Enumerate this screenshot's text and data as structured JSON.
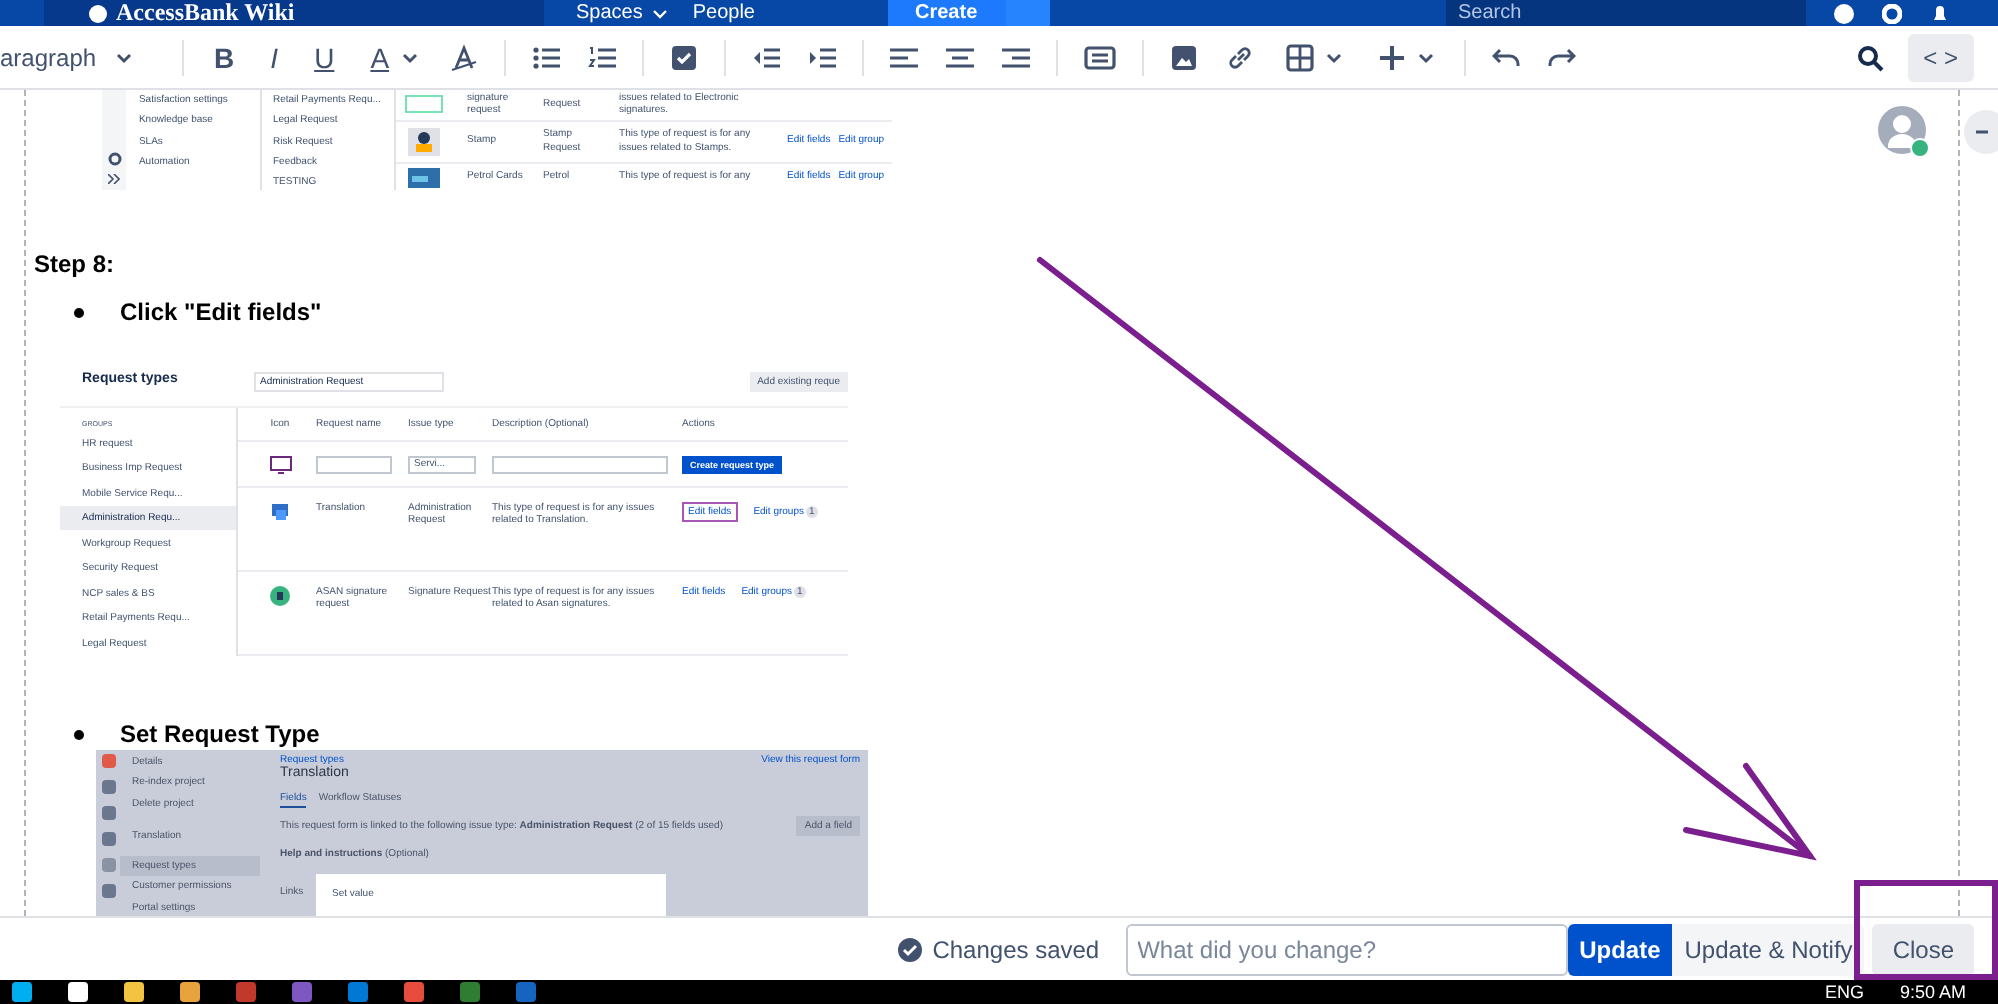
{
  "top_nav": {
    "logo": "AccessBank Wiki",
    "links": [
      "Spaces",
      "People"
    ],
    "create": "Create",
    "search_placeholder": "Search"
  },
  "toolbar": {
    "style_dropdown": "aragraph",
    "format_buttons": [
      {
        "label": "B",
        "kind": "bold"
      },
      {
        "label": "I",
        "kind": "italic"
      },
      {
        "label": "U",
        "kind": "underline"
      }
    ],
    "text_color": "A",
    "code_button": "< >"
  },
  "document": {
    "screenshot_top": {
      "sidebar": [
        "Satisfaction settings",
        "Knowledge base",
        "SLAs",
        "Automation"
      ],
      "groups": [
        "Retail Payments Requ...",
        "Legal Request",
        "Risk Request",
        "Feedback",
        "TESTING"
      ],
      "rows": [
        {
          "name": "signature request",
          "type": "Request",
          "description": "issues related to Electronic signatures.",
          "actions": []
        },
        {
          "name": "Stamp",
          "type": "Stamp Request",
          "description": "This type of request is for any issues related to Stamps.",
          "actions": [
            "Edit fields",
            "Edit group"
          ]
        },
        {
          "name": "Petrol Cards",
          "type": "Petrol",
          "description": "This type of request is for any",
          "actions": [
            "Edit fields",
            "Edit group"
          ]
        }
      ]
    },
    "step_heading": "Step 8:",
    "bullet_1": "Click \"Edit fields\"",
    "screenshot_request_types": {
      "title": "Request types",
      "search_value": "Administration Request",
      "add_button": "Add existing reque",
      "groups_label": "GROUPS",
      "groups": [
        {
          "label": "HR request",
          "selected": false
        },
        {
          "label": "Business Imp Request",
          "selected": false
        },
        {
          "label": "Mobile Service Requ...",
          "selected": false
        },
        {
          "label": "Administration Requ...",
          "selected": true
        },
        {
          "label": "Workgroup Request",
          "selected": false
        },
        {
          "label": "Security Request",
          "selected": false
        },
        {
          "label": "NCP sales & BS",
          "selected": false
        },
        {
          "label": "Retail Payments Requ...",
          "selected": false
        },
        {
          "label": "Legal Request",
          "selected": false
        }
      ],
      "columns": [
        "Icon",
        "Request name",
        "Issue type",
        "Description (Optional)",
        "Actions"
      ],
      "new_row": {
        "issue_type": "Servi...",
        "create_button": "Create request type"
      },
      "rows": [
        {
          "name": "Translation",
          "type": "Administration Request",
          "description": "This type of request is for any issues related to Translation.",
          "edit_fields": "Edit fields",
          "highlighted": true,
          "edit_groups": "Edit groups",
          "group_count": "1"
        },
        {
          "name": "ASAN signature request",
          "type": "Signature Request",
          "description": "This type of request is for any issues related to Asan signatures.",
          "edit_fields": "Edit fields",
          "highlighted": false,
          "edit_groups": "Edit groups",
          "group_count": "1"
        }
      ]
    },
    "bullet_2": "Set Request Type",
    "screenshot_translation": {
      "sidebar": [
        {
          "label": "Details",
          "selected": false
        },
        {
          "label": "Re-index project",
          "selected": false
        },
        {
          "label": "Delete project",
          "selected": false
        },
        {
          "label": "Translation",
          "selected": false
        },
        {
          "label": "Request types",
          "selected": true
        },
        {
          "label": "Customer permissions",
          "selected": false
        },
        {
          "label": "Portal settings",
          "selected": false
        }
      ],
      "breadcrumb": "Request types",
      "title": "Translation",
      "view_link": "View this request form",
      "tabs": [
        {
          "label": "Fields",
          "selected": true
        },
        {
          "label": "Workflow Statuses",
          "selected": false
        }
      ],
      "info": "This request form is linked to the following issue type: **Administration Request** (2 of 15 fields used)",
      "add_field": "Add a field",
      "help_label": "**Help and instructions** (Optional)",
      "links_label": "Links",
      "dialog_title": "Set value"
    }
  },
  "bottom_bar": {
    "status": "Changes saved",
    "comment_placeholder": "What did you change?",
    "update": "Update",
    "update_notify": "Update & Notify",
    "close": "Close"
  },
  "taskbar": {
    "language": "ENG",
    "time": "9:50 AM"
  }
}
